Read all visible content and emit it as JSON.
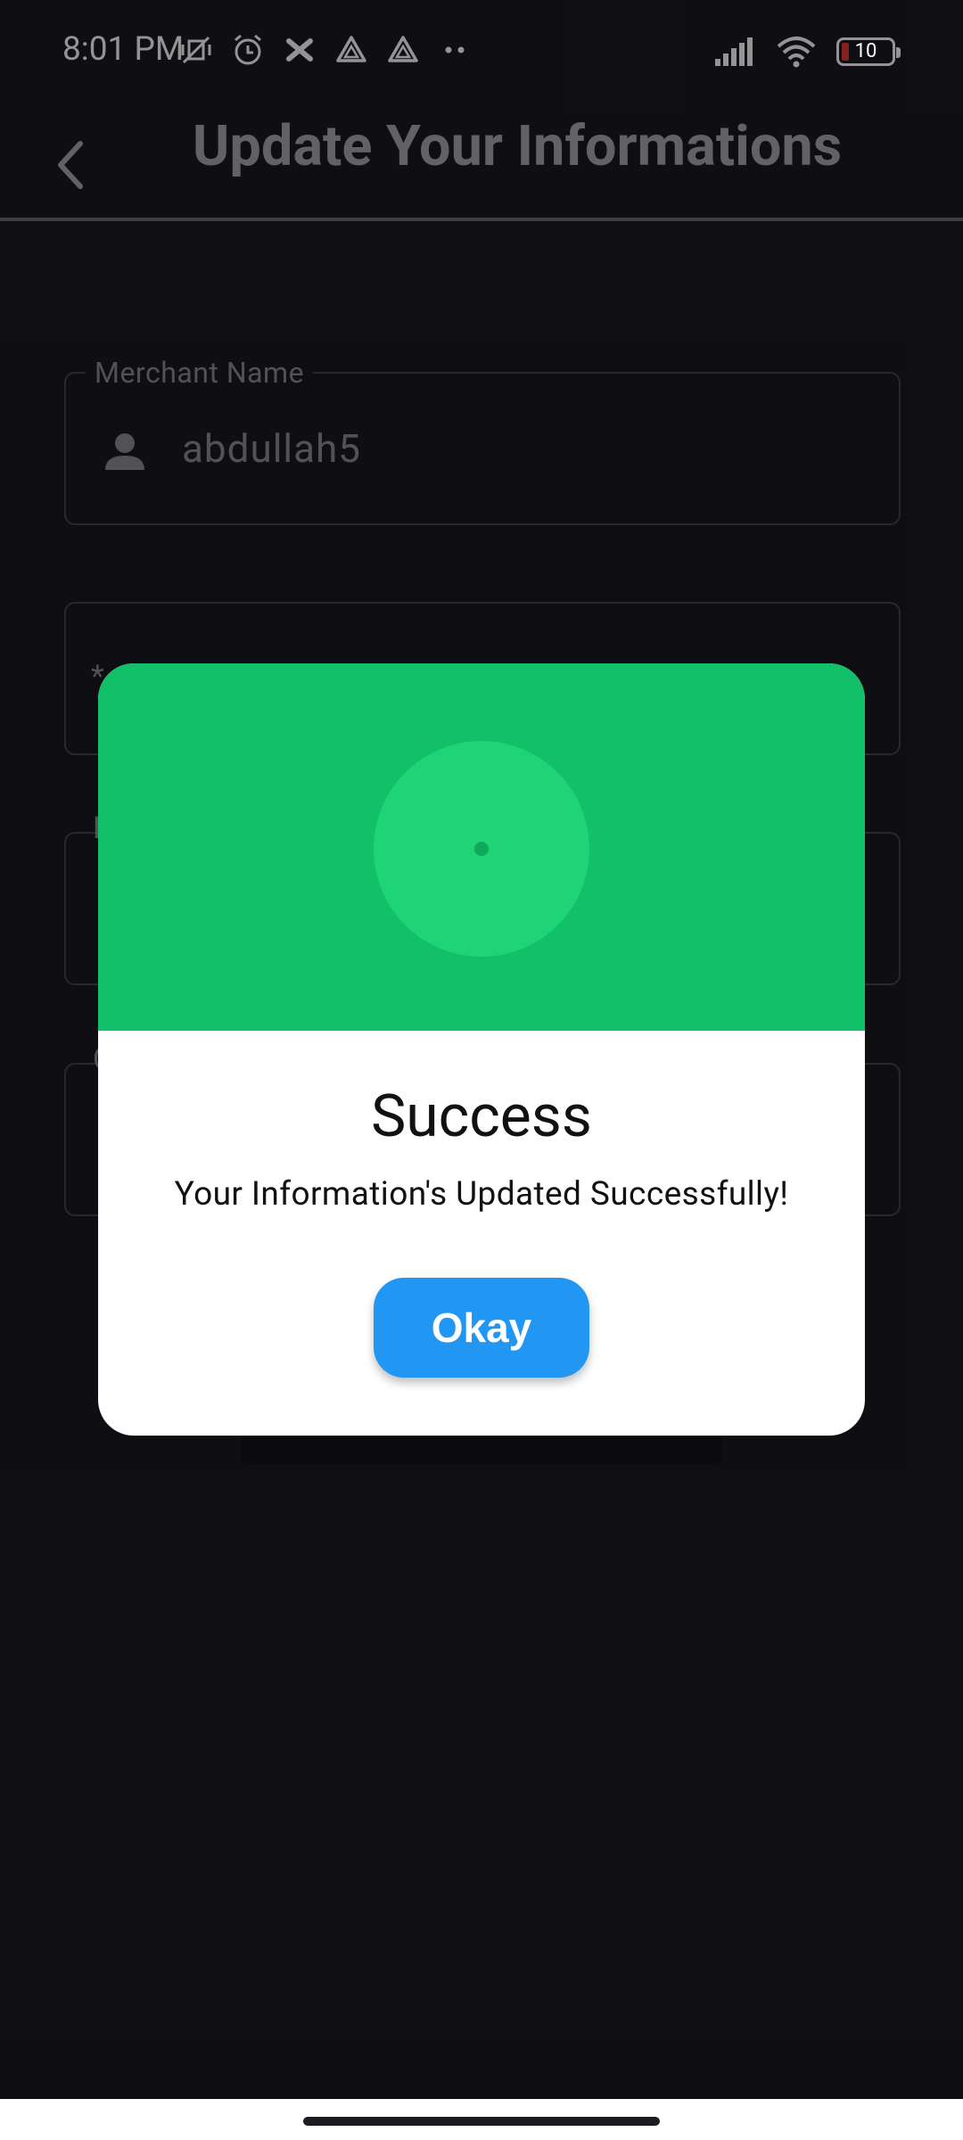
{
  "status_bar": {
    "time": "8:01 PM",
    "left_icons": [
      "vibrate-off-icon",
      "alarm-icon",
      "app-x-icon",
      "drive-icon",
      "drive-icon",
      "more-dots-icon"
    ],
    "right_icons": [
      "signal-icon",
      "wifi-icon",
      "battery-icon"
    ],
    "battery_level": "10"
  },
  "app_bar": {
    "title": "Update Your Informations",
    "back_icon": "chevron-left-icon"
  },
  "form": {
    "merchant_name": {
      "label": "Merchant Name",
      "value": "abdullah5",
      "icon": "person-icon"
    },
    "field2": {
      "stub": "*"
    },
    "field3": {
      "stub": "E"
    },
    "field4": {
      "stub": "C"
    }
  },
  "dialog": {
    "title": "Success",
    "message": "Your Information's Updated Successfully!",
    "button_label": "Okay",
    "header_color": "#13c06a",
    "button_color": "#2196f3"
  }
}
